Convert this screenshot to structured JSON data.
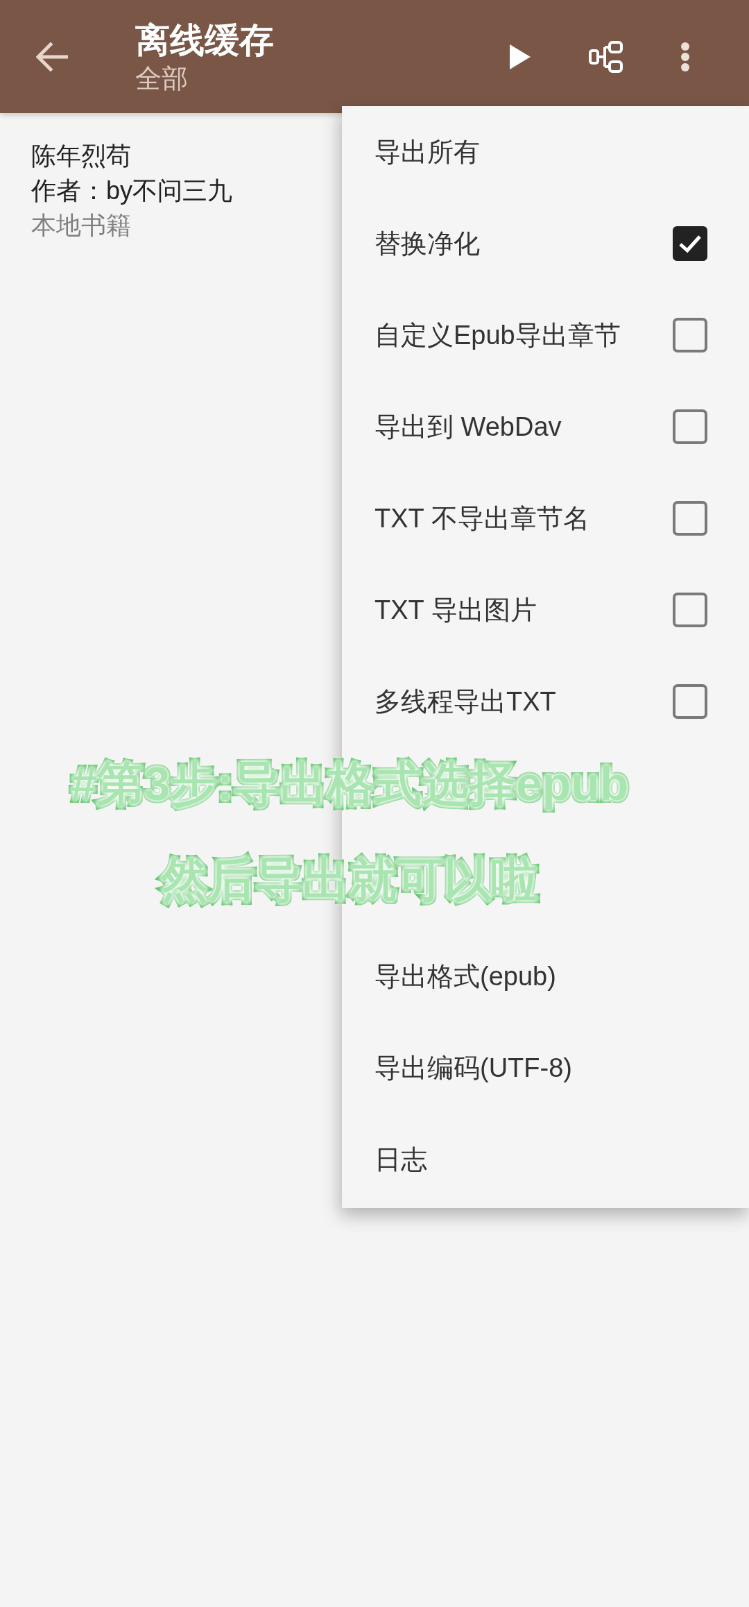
{
  "app_bar": {
    "title": "离线缓存",
    "subtitle": "全部"
  },
  "books": [
    {
      "title": "陈年烈苟",
      "author": "作者：by不问三九",
      "source": "本地书籍"
    }
  ],
  "menu": {
    "groups": [
      {
        "items": [
          {
            "kind": "action",
            "label": "导出所有"
          },
          {
            "kind": "check",
            "label": "替换净化",
            "checked": true
          },
          {
            "kind": "check",
            "label": "自定义Epub导出章节",
            "checked": false
          },
          {
            "kind": "check",
            "label": "导出到 WebDav",
            "checked": false
          },
          {
            "kind": "check",
            "label": "TXT 不导出章节名",
            "checked": false
          },
          {
            "kind": "check",
            "label": "TXT 导出图片",
            "checked": false
          },
          {
            "kind": "check",
            "label": "多线程导出TXT",
            "checked": false
          }
        ]
      },
      {
        "items": [
          {
            "kind": "action",
            "label": "导出格式(epub)"
          },
          {
            "kind": "action",
            "label": "导出编码(UTF-8)"
          },
          {
            "kind": "action",
            "label": "日志"
          }
        ]
      }
    ]
  },
  "caption": [
    "#第3步:导出格式选择epub",
    "然后导出就可以啦"
  ]
}
